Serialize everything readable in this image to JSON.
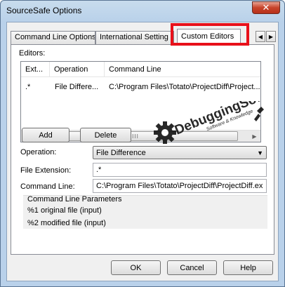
{
  "window": {
    "title": "SourceSafe Options",
    "close_glyph": "✕"
  },
  "tabs": [
    {
      "label": "Command Line Options"
    },
    {
      "label": "International Setting"
    },
    {
      "label": "Custom Editors",
      "active": true
    }
  ],
  "tab_arrows": {
    "left": "◀",
    "right": "▶"
  },
  "editors": {
    "label": "Editors:",
    "columns": [
      "Ext...",
      "Operation",
      "Command Line"
    ],
    "rows": [
      {
        "ext": ".*",
        "operation": "File Differe...",
        "command_line": "C:\\Program Files\\Totato\\ProjectDiff\\Project..."
      }
    ],
    "scroll": {
      "left": "◀",
      "right": "▶",
      "grip": "III"
    }
  },
  "buttons": {
    "add": "Add",
    "delete": "Delete",
    "ok": "OK",
    "cancel": "Cancel",
    "help": "Help"
  },
  "operation": {
    "label": "Operation:",
    "value": "File Difference"
  },
  "file_extension": {
    "label": "File Extension:",
    "value": ".*"
  },
  "command_line": {
    "label": "Command Line:",
    "value": "C:\\Program Files\\Totato\\ProjectDiff\\ProjectDiff.ex"
  },
  "params": {
    "title": "Command Line Parameters",
    "items": [
      "%1 original file (input)",
      "%2 modified file (input)"
    ]
  },
  "watermark": {
    "brand": "DebuggingSoft",
    "tagline": "Software & Knowledge"
  },
  "colors": {
    "highlight": "#e8101a",
    "titlebar": "#b9d1ea"
  }
}
